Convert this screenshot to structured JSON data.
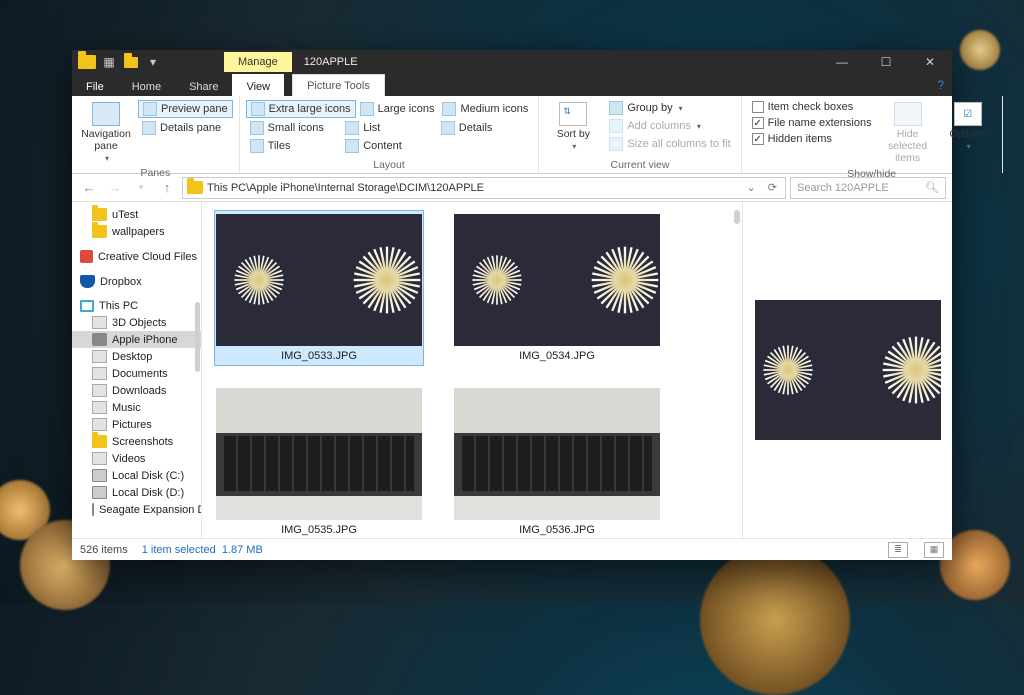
{
  "title": {
    "manage": "Manage",
    "text": "120APPLE",
    "context_tab": "Picture Tools"
  },
  "menu": [
    "File",
    "Home",
    "Share",
    "View"
  ],
  "ribbon": {
    "panes": {
      "nav": "Navigation pane",
      "preview": "Preview pane",
      "details": "Details pane",
      "label": "Panes"
    },
    "layout": {
      "xl": "Extra large icons",
      "lg": "Large icons",
      "md": "Medium icons",
      "sm": "Small icons",
      "list": "List",
      "details": "Details",
      "tiles": "Tiles",
      "content": "Content",
      "label": "Layout"
    },
    "cv": {
      "sort": "Sort by",
      "group": "Group by",
      "addcols": "Add columns",
      "sizecols": "Size all columns to fit",
      "label": "Current view"
    },
    "sh": {
      "checkboxes": "Item check boxes",
      "ext": "File name extensions",
      "hidden": "Hidden items",
      "hide": "Hide selected items",
      "options": "Options",
      "label": "Show/hide"
    }
  },
  "address": {
    "path": "This PC\\Apple iPhone\\Internal Storage\\DCIM\\120APPLE",
    "search_placeholder": "Search 120APPLE"
  },
  "tree": [
    {
      "label": "uTest",
      "icon": "f",
      "lvl": 2
    },
    {
      "label": "wallpapers",
      "icon": "f",
      "lvl": 2
    },
    {
      "label": "Creative Cloud Files",
      "icon": "cc",
      "lvl": 1,
      "gap": true
    },
    {
      "label": "Dropbox",
      "icon": "db",
      "lvl": 1,
      "gap": true
    },
    {
      "label": "This PC",
      "icon": "pc",
      "lvl": 1,
      "gap": true
    },
    {
      "label": "3D Objects",
      "icon": "generic",
      "lvl": 2
    },
    {
      "label": "Apple iPhone",
      "icon": "dev",
      "lvl": 2,
      "sel": true
    },
    {
      "label": "Desktop",
      "icon": "generic",
      "lvl": 2
    },
    {
      "label": "Documents",
      "icon": "generic",
      "lvl": 2
    },
    {
      "label": "Downloads",
      "icon": "generic",
      "lvl": 2
    },
    {
      "label": "Music",
      "icon": "generic",
      "lvl": 2
    },
    {
      "label": "Pictures",
      "icon": "generic",
      "lvl": 2
    },
    {
      "label": "Screenshots",
      "icon": "f",
      "lvl": 2
    },
    {
      "label": "Videos",
      "icon": "generic",
      "lvl": 2
    },
    {
      "label": "Local Disk (C:)",
      "icon": "hd",
      "lvl": 2
    },
    {
      "label": "Local Disk (D:)",
      "icon": "hd",
      "lvl": 2
    },
    {
      "label": "Seagate Expansion Drive",
      "icon": "hd",
      "lvl": 2
    }
  ],
  "files": [
    {
      "name": "IMG_0533.JPG",
      "kind": "star",
      "sel": true
    },
    {
      "name": "IMG_0534.JPG",
      "kind": "star"
    },
    {
      "name": "IMG_0535.JPG",
      "kind": "kb"
    },
    {
      "name": "IMG_0536.JPG",
      "kind": "kb"
    }
  ],
  "status": {
    "count": "526 items",
    "selection": "1 item selected",
    "size": "1.87 MB"
  }
}
